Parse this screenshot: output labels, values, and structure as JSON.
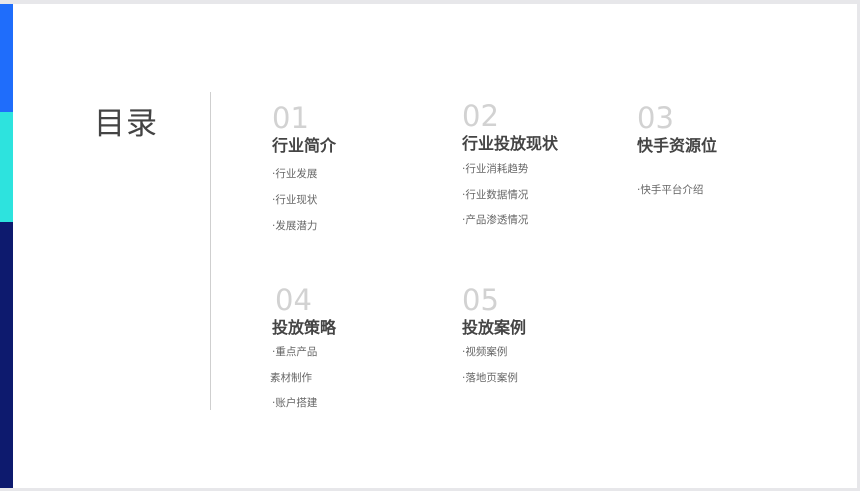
{
  "colors": {
    "stripe_top": "#1f6dfb",
    "stripe_middle": "#2de3de",
    "stripe_bottom": "#0d1a6e",
    "number": "#d2d2d2",
    "heading": "#444444",
    "item": "#666666"
  },
  "title": "目录",
  "sections": [
    {
      "number": "01",
      "heading": "行业简介",
      "items": [
        "·行业发展",
        "·行业现状",
        "·发展潜力"
      ]
    },
    {
      "number": "02",
      "heading": "行业投放现状",
      "items": [
        "·行业消耗趋势",
        "·行业数据情况",
        "·产品渗透情况"
      ]
    },
    {
      "number": "03",
      "heading": "快手资源位",
      "items": [
        "·快手平台介绍"
      ]
    },
    {
      "number": "04",
      "heading": "投放策略",
      "items": [
        "·重点产品",
        "素材制作",
        "·账户搭建"
      ]
    },
    {
      "number": "05",
      "heading": "投放案例",
      "items": [
        "·视频案例",
        "·落地页案例"
      ]
    }
  ]
}
